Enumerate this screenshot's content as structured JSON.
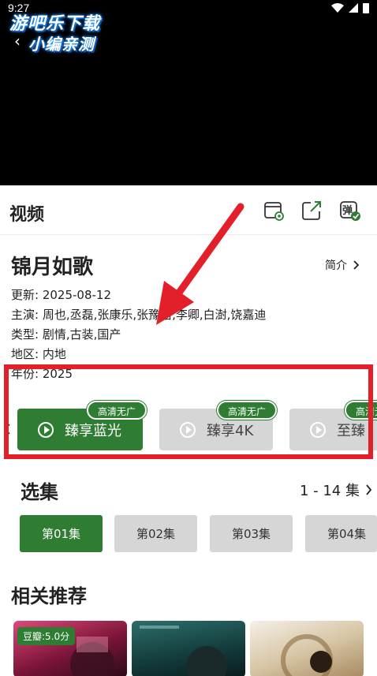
{
  "status": {
    "time": "9:27"
  },
  "watermark": {
    "line1": "游吧乐下载",
    "line2": "小编亲测"
  },
  "header": {
    "title": "视频"
  },
  "icons": {
    "back": "back-icon",
    "download": "download-icon",
    "share": "share-icon",
    "danmaku": "danmaku-icon",
    "danmaku_char": "弹"
  },
  "show": {
    "title": "锦月如歌",
    "intro_label": "简介",
    "info": [
      "更新:  2025-08-12",
      "主演:  周也,丞磊,张康乐,张豫怡,李卿,白澍,饶嘉迪",
      "类型:  剧情,古装,国产",
      "地区:  内地",
      "年份:  2025"
    ]
  },
  "quality": [
    {
      "label": "臻享蓝光",
      "badge": "高清无广",
      "active": true
    },
    {
      "label": "臻享4K",
      "badge": "高清无广",
      "active": false
    },
    {
      "label": "至臻",
      "badge": "高清无广",
      "active": false
    }
  ],
  "episodes": {
    "title": "选集",
    "range": "1 - 14 集",
    "items": [
      "第01集",
      "第02集",
      "第03集",
      "第04集"
    ]
  },
  "recommend": {
    "title": "相关推荐",
    "first_badge": "豆瓣:5.0分"
  },
  "colors": {
    "accent": "#2e7d32",
    "highlight": "#e3202a"
  }
}
